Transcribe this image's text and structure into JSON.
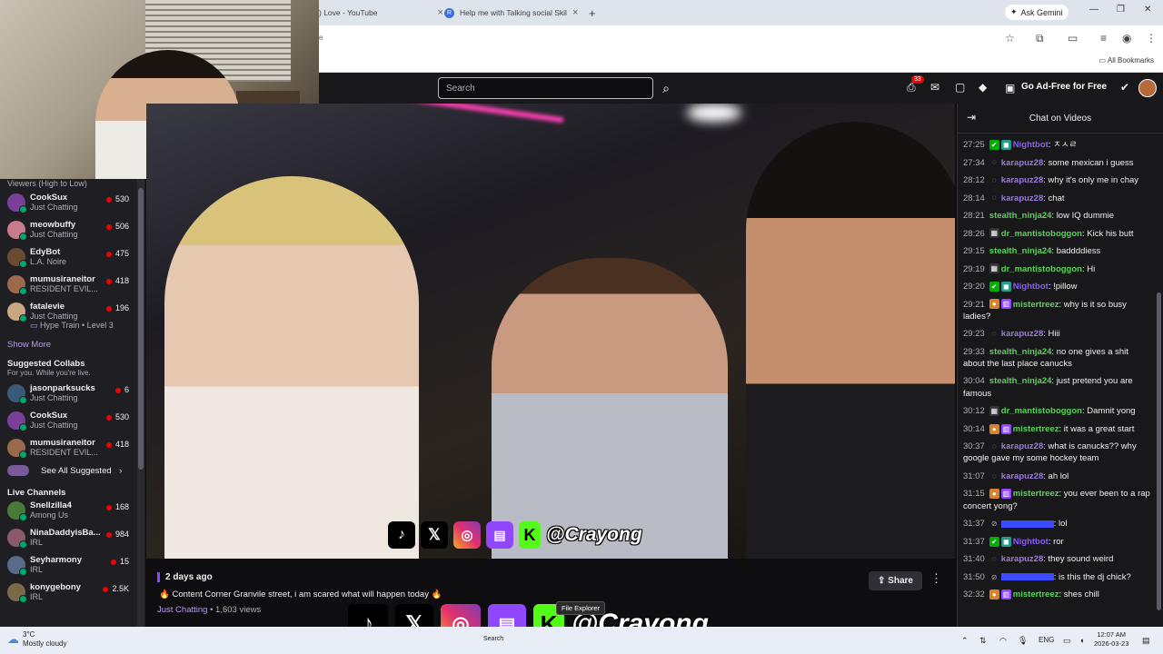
{
  "browser": {
    "tabs": [
      {
        "label": ") Love - YouTube"
      },
      {
        "label": "Help me with Talking social Skil"
      }
    ],
    "new_tab_glyph": "+",
    "ask_gemini": "Ask Gemini",
    "omnibox_fragment": "e",
    "all_bookmarks": "All Bookmarks"
  },
  "twitch": {
    "search_placeholder": "Search",
    "notifications_count": "33",
    "go_ad_free": "Go Ad-Free for Free"
  },
  "sidebar": {
    "section_hint": "Viewers (High to Low)",
    "followed": [
      {
        "name": "CookSux",
        "game": "Just Chatting",
        "viewers": "530",
        "color": "#7a3f9a"
      },
      {
        "name": "meowbuffy",
        "game": "Just Chatting",
        "viewers": "506",
        "color": "#c77b8d"
      },
      {
        "name": "EdyBot",
        "game": "L.A. Noire",
        "viewers": "475",
        "color": "#6b4a32"
      },
      {
        "name": "mumusiraneitor",
        "game": "RESIDENT EVIL...",
        "viewers": "418",
        "color": "#9a6a4a"
      },
      {
        "name": "fatalevie",
        "game": "Just Chatting",
        "viewers": "196",
        "extra": "Hype Train • Level 3",
        "color": "#c9a780"
      }
    ],
    "show_more": "Show More",
    "suggested_title": "Suggested Collabs",
    "suggested_sub": "For you. While you're live.",
    "suggested": [
      {
        "name": "jasonparksucks",
        "game": "Just Chatting",
        "viewers": "6",
        "color": "#3a5a7a"
      },
      {
        "name": "CookSux",
        "game": "Just Chatting",
        "viewers": "530",
        "color": "#7a3f9a"
      },
      {
        "name": "mumusiraneitor",
        "game": "RESIDENT EVIL...",
        "viewers": "418",
        "color": "#9a6a4a"
      }
    ],
    "see_all": "See All Suggested",
    "live_title": "Live Channels",
    "live": [
      {
        "name": "Snellzilla4",
        "game": "Among Us",
        "viewers": "168",
        "color": "#4a7a3a"
      },
      {
        "name": "NinaDaddyisBa...",
        "game": "IRL",
        "viewers": "984",
        "color": "#8a5a6a"
      },
      {
        "name": "Seyharmony",
        "game": "IRL",
        "viewers": "15",
        "color": "#5a6a8a"
      },
      {
        "name": "konygebony",
        "game": "IRL",
        "viewers": "2.5K",
        "color": "#7a6a4a"
      }
    ]
  },
  "video": {
    "date": "2 days ago",
    "title": "🔥 Content Corner Granvile street, i am scared what will happen today 🔥",
    "category": "Just Chatting",
    "views": " • 1,603 views",
    "share": "Share",
    "handle": "@Crayong",
    "handle_large": "@Crayong",
    "tooltip": "File Explorer"
  },
  "chat": {
    "title": "Chat on Videos",
    "messages": [
      {
        "t": "27:25",
        "user": "Nightbot",
        "color": "#8b5cf6",
        "badges": [
          "mod",
          "vip"
        ],
        "text": ": ㅈㅅㄹ"
      },
      {
        "t": "27:34",
        "user": "karapuz28",
        "color": "#9a7ad8",
        "badges": [
          "none"
        ],
        "text": ": some mexican i guess"
      },
      {
        "t": "28:12",
        "user": "karapuz28",
        "color": "#9a7ad8",
        "badges": [
          "none"
        ],
        "text": ": why it's only me in chay"
      },
      {
        "t": "28:14",
        "user": "karapuz28",
        "color": "#9a7ad8",
        "badges": [
          "none"
        ],
        "text": ": chat"
      },
      {
        "t": "28:21",
        "user": "stealth_ninja24",
        "color": "#5ad25a",
        "badges": [],
        "text": ": low IQ dummie"
      },
      {
        "t": "28:26",
        "user": "dr_mantistoboggon",
        "color": "#5ad25a",
        "badges": [
          "bot"
        ],
        "text": ": Kick his butt"
      },
      {
        "t": "29:15",
        "user": "stealth_ninja24",
        "color": "#5ad25a",
        "badges": [],
        "text": ": baddddiess"
      },
      {
        "t": "29:19",
        "user": "dr_mantistoboggon",
        "color": "#5ad25a",
        "badges": [
          "bot"
        ],
        "text": ": Hi"
      },
      {
        "t": "29:20",
        "user": "Nightbot",
        "color": "#8b5cf6",
        "badges": [
          "mod",
          "vip"
        ],
        "text": ": !pillow"
      },
      {
        "t": "29:21",
        "user": "mistertreez",
        "color": "#5ad25a",
        "badges": [
          "ball",
          "gift"
        ],
        "text": ": why is it so busy ladies?"
      },
      {
        "t": "29:23",
        "user": "karapuz28",
        "color": "#9a7ad8",
        "badges": [
          "none"
        ],
        "text": ": Hiii"
      },
      {
        "t": "29:33",
        "user": "stealth_ninja24",
        "color": "#5ad25a",
        "badges": [],
        "text": ": no one gives a shit about the last place canucks"
      },
      {
        "t": "30:04",
        "user": "stealth_ninja24",
        "color": "#5ad25a",
        "badges": [],
        "text": ": just pretend you are famous"
      },
      {
        "t": "30:12",
        "user": "dr_mantistoboggon",
        "color": "#5ad25a",
        "badges": [
          "bot"
        ],
        "text": ": Damnit yong"
      },
      {
        "t": "30:14",
        "user": "mistertreez",
        "color": "#5ad25a",
        "badges": [
          "ball",
          "gift"
        ],
        "text": ": it was a great start"
      },
      {
        "t": "30:37",
        "user": "karapuz28",
        "color": "#9a7ad8",
        "badges": [
          "none"
        ],
        "text": ": what is canucks?? why google gave my some hockey team"
      },
      {
        "t": "31:07",
        "user": "karapuz28",
        "color": "#9a7ad8",
        "badges": [
          "none"
        ],
        "text": ": ah lol"
      },
      {
        "t": "31:15",
        "user": "mistertreez",
        "color": "#5ad25a",
        "badges": [
          "ball",
          "gift"
        ],
        "text": ": you ever been to a rap concert yong?"
      },
      {
        "t": "31:37",
        "user": "",
        "color": "#3b4bff",
        "badges": [
          "ban"
        ],
        "text": ": lol"
      },
      {
        "t": "31:37",
        "user": "Nightbot",
        "color": "#8b5cf6",
        "badges": [
          "mod",
          "vip"
        ],
        "text": ": ror"
      },
      {
        "t": "31:40",
        "user": "karapuz28",
        "color": "#9a7ad8",
        "badges": [
          "none"
        ],
        "text": ": they sound weird"
      },
      {
        "t": "31:50",
        "user": "",
        "color": "#3b4bff",
        "badges": [
          "ban"
        ],
        "text": ": is this the dj chick?"
      },
      {
        "t": "32:32",
        "user": "mistertreez",
        "color": "#5ad25a",
        "badges": [
          "ball",
          "gift"
        ],
        "text": ": shes chill"
      }
    ]
  },
  "taskbar": {
    "temp": "3°C",
    "weather": "Mostly cloudy",
    "search": "Search",
    "lang": "ENG",
    "time": "12:07 AM",
    "date": "2026-03-23"
  },
  "colors": {
    "accent": "#9147ff",
    "live_red": "#eb0400"
  }
}
